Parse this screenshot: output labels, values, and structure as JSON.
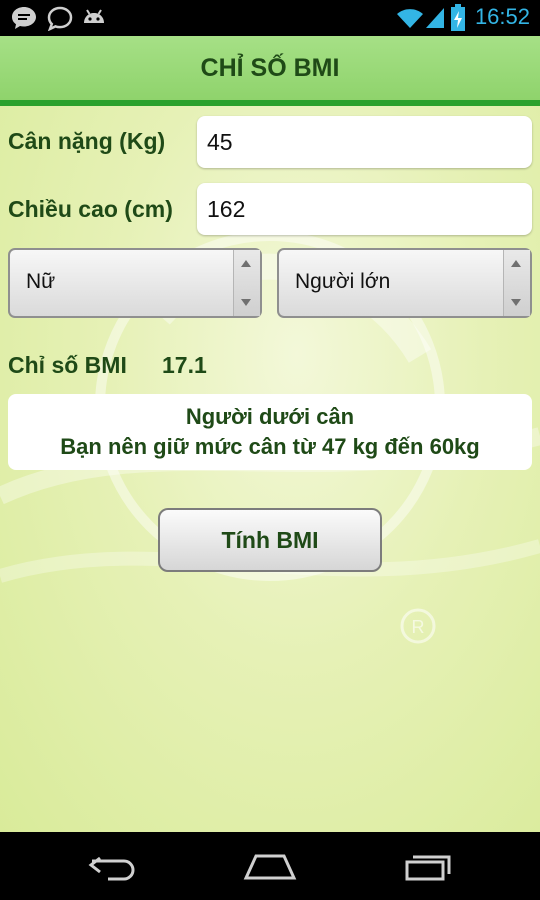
{
  "status_bar": {
    "time": "16:52",
    "icons": [
      "chat-bubble-icon",
      "speech-bubble-icon",
      "android-icon",
      "wifi-icon",
      "signal-icon",
      "battery-icon"
    ]
  },
  "header": {
    "title": "CHỈ SỐ BMI"
  },
  "form": {
    "weight_label": "Cân nặng (Kg)",
    "weight_value": "45",
    "height_label": "Chiều cao (cm)",
    "height_value": "162",
    "gender_selected": "Nữ",
    "age_group_selected": "Người lớn"
  },
  "bmi": {
    "label": "Chỉ số BMI",
    "value": "17.1"
  },
  "result": {
    "line1": "Người dưới cân",
    "line2": "Bạn nên giữ mức cân từ  47 kg đến 60kg"
  },
  "actions": {
    "calculate_label": "Tính BMI"
  },
  "nav": {
    "icons": [
      "back-icon",
      "home-icon",
      "recent-apps-icon"
    ]
  },
  "colors": {
    "title_text": "#1f4a17",
    "header_green": "#8fd36c",
    "header_line": "#2aa12c",
    "background": "#e6f1b6",
    "clock": "#33b5e5"
  }
}
